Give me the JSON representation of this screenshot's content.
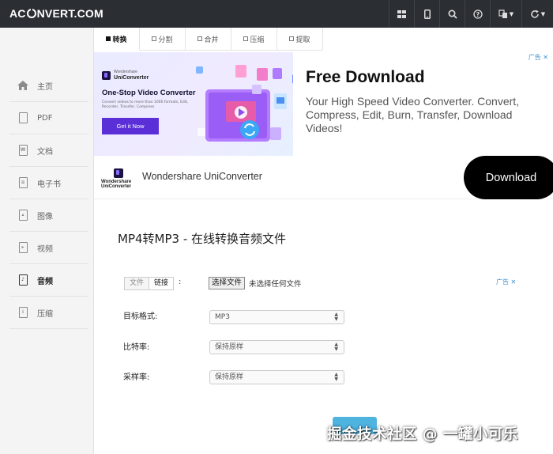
{
  "header": {
    "logo": {
      "left": "AC",
      "right": "NVERT.COM"
    },
    "icons": [
      "grid-icon",
      "mobile-icon",
      "search-icon",
      "help-icon",
      "language-icon",
      "refresh-icon"
    ]
  },
  "sidebar": {
    "items": [
      {
        "label": "主页",
        "icon": "home-icon"
      },
      {
        "label": "PDF",
        "icon": "pdf-icon"
      },
      {
        "label": "文档",
        "icon": "document-icon"
      },
      {
        "label": "电子书",
        "icon": "ebook-icon"
      },
      {
        "label": "图像",
        "icon": "image-icon"
      },
      {
        "label": "视频",
        "icon": "video-icon"
      },
      {
        "label": "音频",
        "icon": "audio-icon",
        "active": true
      },
      {
        "label": "压缩",
        "icon": "archive-icon"
      }
    ]
  },
  "tabs": [
    {
      "label": "转换",
      "active": true
    },
    {
      "label": "分割"
    },
    {
      "label": "合并"
    },
    {
      "label": "压缩"
    },
    {
      "label": "提取"
    }
  ],
  "ad": {
    "tag": "广告 ✕",
    "image": {
      "brand_line1": "Wondershare",
      "brand_line2": "UniConverter",
      "headline": "One-Stop Video Converter",
      "body": "Convert videos to more than 1000 formats, Edit, Recorder, Transfer, Compress",
      "cta": "Get it Now"
    },
    "title": "Free Download",
    "description": "Your High Speed Video Converter. Convert, Compress, Edit, Burn, Transfer, Download Videos!",
    "bottom_logo_line1": "Wondershare",
    "bottom_logo_line2": "UniConverter",
    "advertiser": "Wondershare UniConverter",
    "download_label": "Download"
  },
  "main": {
    "heading": "MP4转MP3 - 在线转换音频文件",
    "source_tabs": [
      "文件",
      "链接"
    ],
    "source_colon": ":",
    "file_button": "选择文件",
    "file_status": "未选择任何文件",
    "ad_tag": "广告 ✕",
    "fields": [
      {
        "label": "目标格式:",
        "value": "MP3"
      },
      {
        "label": "比特率:",
        "value": "保持原样"
      },
      {
        "label": "采样率:",
        "value": "保持原样"
      }
    ]
  },
  "watermark": "掘金技术社区 @ 一罐小可乐",
  "colors": {
    "topbar": "#2b2f33",
    "sidebar": "#f4f4f4",
    "ad_cta": "#5b2fd8",
    "convert_button": "#4fb3e0"
  }
}
